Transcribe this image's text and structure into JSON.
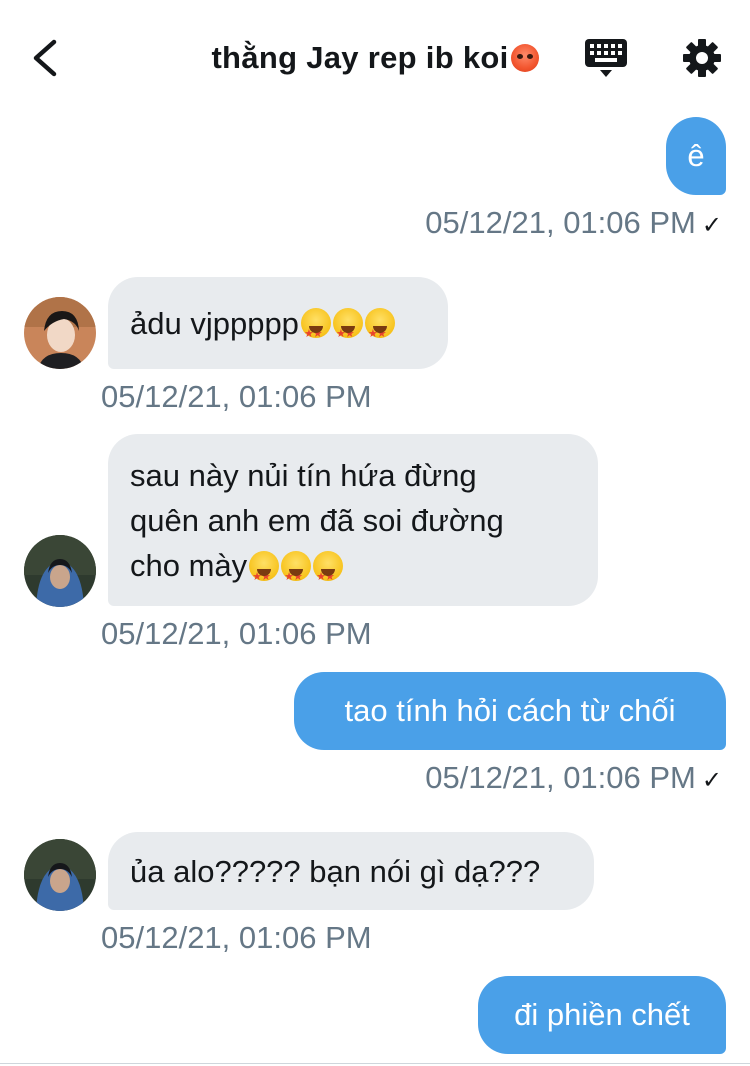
{
  "header": {
    "title": "thằng Jay rep ib koi",
    "title_emoji": "angry-face-icon"
  },
  "messages": [
    {
      "direction": "out",
      "text": "ê",
      "time": "05/12/21, 01:06 PM",
      "read_mark": "✓"
    },
    {
      "direction": "in",
      "text": "ảdu vjppppp",
      "emoji": "star-struck-icon",
      "emoji_count": 3,
      "time": "05/12/21, 01:06 PM",
      "avatar": "avatar-1"
    },
    {
      "direction": "in",
      "lines": [
        "sau này nủi tín hứa đừng",
        "quên anh em đã soi đường",
        "cho mày"
      ],
      "emoji": "star-struck-icon",
      "emoji_count": 3,
      "time": "05/12/21, 01:06 PM",
      "avatar": "avatar-2"
    },
    {
      "direction": "out",
      "text": "tao tính hỏi cách từ chối",
      "time": "05/12/21, 01:06 PM",
      "read_mark": "✓"
    },
    {
      "direction": "in",
      "text": "ủa alo????? bạn nói gì dạ???",
      "time": "05/12/21, 01:06 PM",
      "avatar": "avatar-2"
    },
    {
      "direction": "out",
      "text": "đi phiền chết"
    }
  ],
  "colors": {
    "outgoing_bubble": "#4aa0e8",
    "incoming_bubble": "#e8ebee",
    "timestamp": "#657786"
  }
}
